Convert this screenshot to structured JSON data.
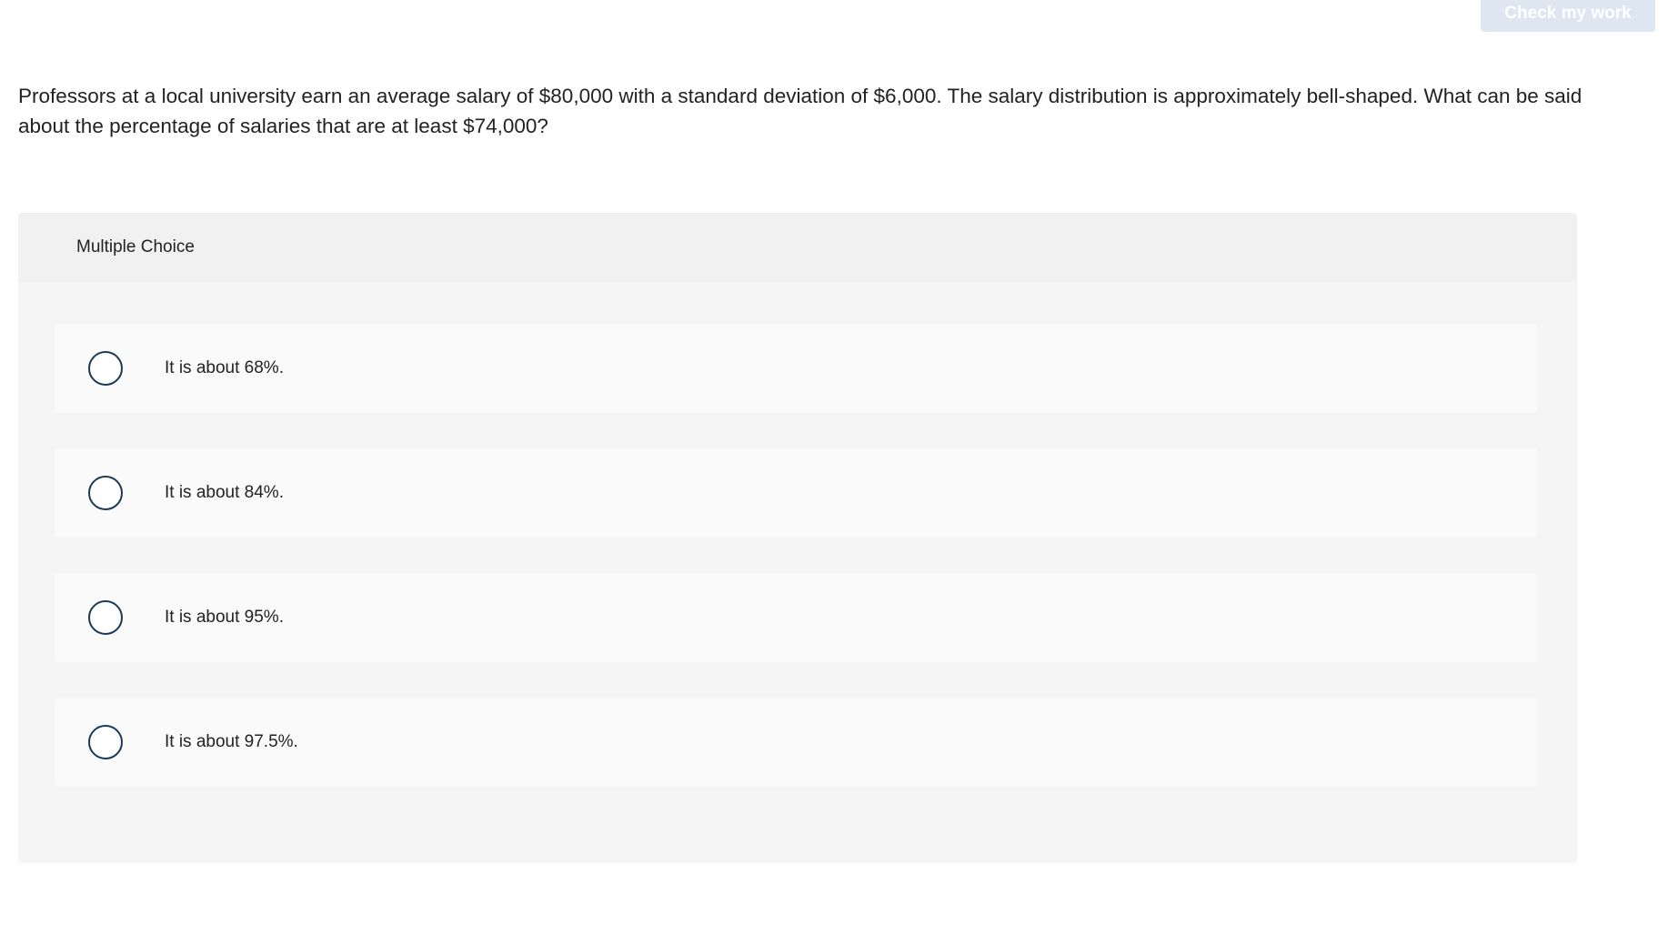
{
  "header": {
    "check_button_label": "Check my work"
  },
  "question": {
    "text": "Professors at a local university earn an average salary of $80,000 with a standard deviation of $6,000. The salary distribution is approximately bell-shaped. What can be said about the percentage of salaries that are at least $74,000?"
  },
  "multiple_choice": {
    "title": "Multiple Choice",
    "options": [
      {
        "label": "It is about 68%."
      },
      {
        "label": "It is about 84%."
      },
      {
        "label": "It is about 95%."
      },
      {
        "label": "It is about 97.5%."
      }
    ]
  },
  "colors": {
    "check_button_bg": "#dde6f1",
    "radio_border": "#1b3a57",
    "panel_bg": "#f5f5f5",
    "option_bg": "#fafafa"
  }
}
